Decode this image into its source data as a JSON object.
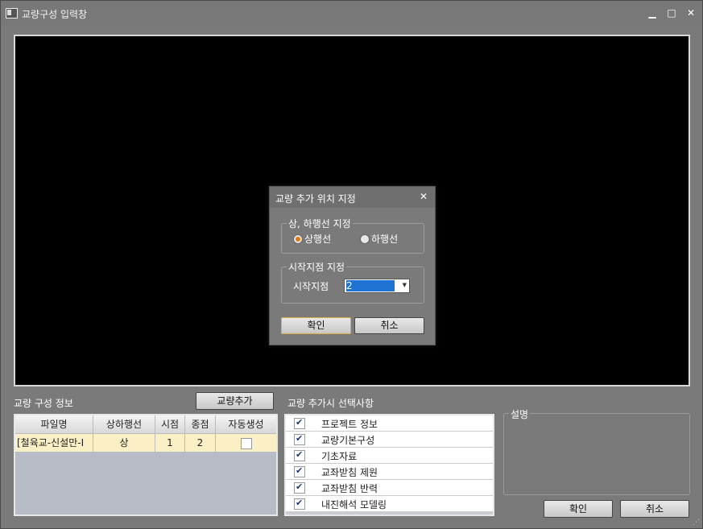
{
  "window": {
    "title": "교량구성 입력창",
    "minimize_glyph": "▁",
    "maximize_glyph": "□",
    "close_glyph": "✕"
  },
  "left_panel": {
    "title": "교량 구성 정보",
    "add_button": "교량추가",
    "columns": [
      "파일명",
      "상하행선",
      "시점",
      "종점",
      "자동생성"
    ],
    "rows": [
      {
        "file": "[철육교-신설만-I",
        "direction": "상",
        "start": "1",
        "end": "2",
        "auto": false
      }
    ]
  },
  "options_panel": {
    "title": "교량 추가시 선택사항",
    "items": [
      {
        "label": "프로젝트 정보",
        "checked": true
      },
      {
        "label": "교량기본구성",
        "checked": true
      },
      {
        "label": "기초자료",
        "checked": true
      },
      {
        "label": "교좌받침 제원",
        "checked": true
      },
      {
        "label": "교좌받침 반력",
        "checked": true
      },
      {
        "label": "내진해석 모델링",
        "checked": true
      }
    ]
  },
  "description": {
    "title": "설명"
  },
  "footer": {
    "ok": "확인",
    "cancel": "취소"
  },
  "dialog": {
    "title": "교량 추가 위치 지정",
    "close_glyph": "✕",
    "direction_group": "상, 하행선 지정",
    "up_line": "상행선",
    "down_line": "하행선",
    "start_group": "시작지점 지정",
    "start_label": "시작지점",
    "start_value": "2",
    "ok": "확인",
    "cancel": "취소"
  },
  "colors": {
    "accent_radio": "#e07a10",
    "selection": "#1e73d2",
    "grid_row": "#fbefc6"
  }
}
